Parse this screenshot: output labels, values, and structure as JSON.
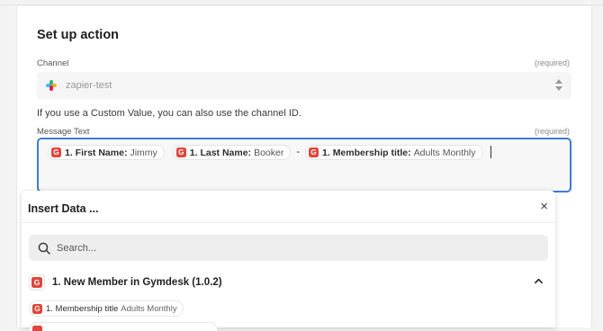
{
  "section_title": "Set up action",
  "channel": {
    "label": "Channel",
    "required": "(required)",
    "value": "zapier-test",
    "help": "If you use a Custom Value, you can also use the channel ID."
  },
  "message": {
    "label": "Message Text",
    "required": "(required)",
    "pills": [
      {
        "key": "1. First Name:",
        "value": "Jimmy"
      },
      {
        "key": "1. Last Name:",
        "value": "Booker"
      },
      {
        "key": "1. Membership title:",
        "value": "Adults Monthly"
      }
    ],
    "separator": "-"
  },
  "insert_data": {
    "title": "Insert Data ...",
    "search_placeholder": "Search...",
    "app_step": "1. New Member in Gymdesk (1.0.2)",
    "fields": [
      {
        "key": "1. Membership title",
        "value": "Adults Monthly"
      }
    ]
  },
  "icons": {
    "app_icon_letter": "G",
    "close": "×"
  },
  "colors": {
    "focus_border": "#3e7bd9",
    "gymdesk_red": "#e2453b"
  }
}
